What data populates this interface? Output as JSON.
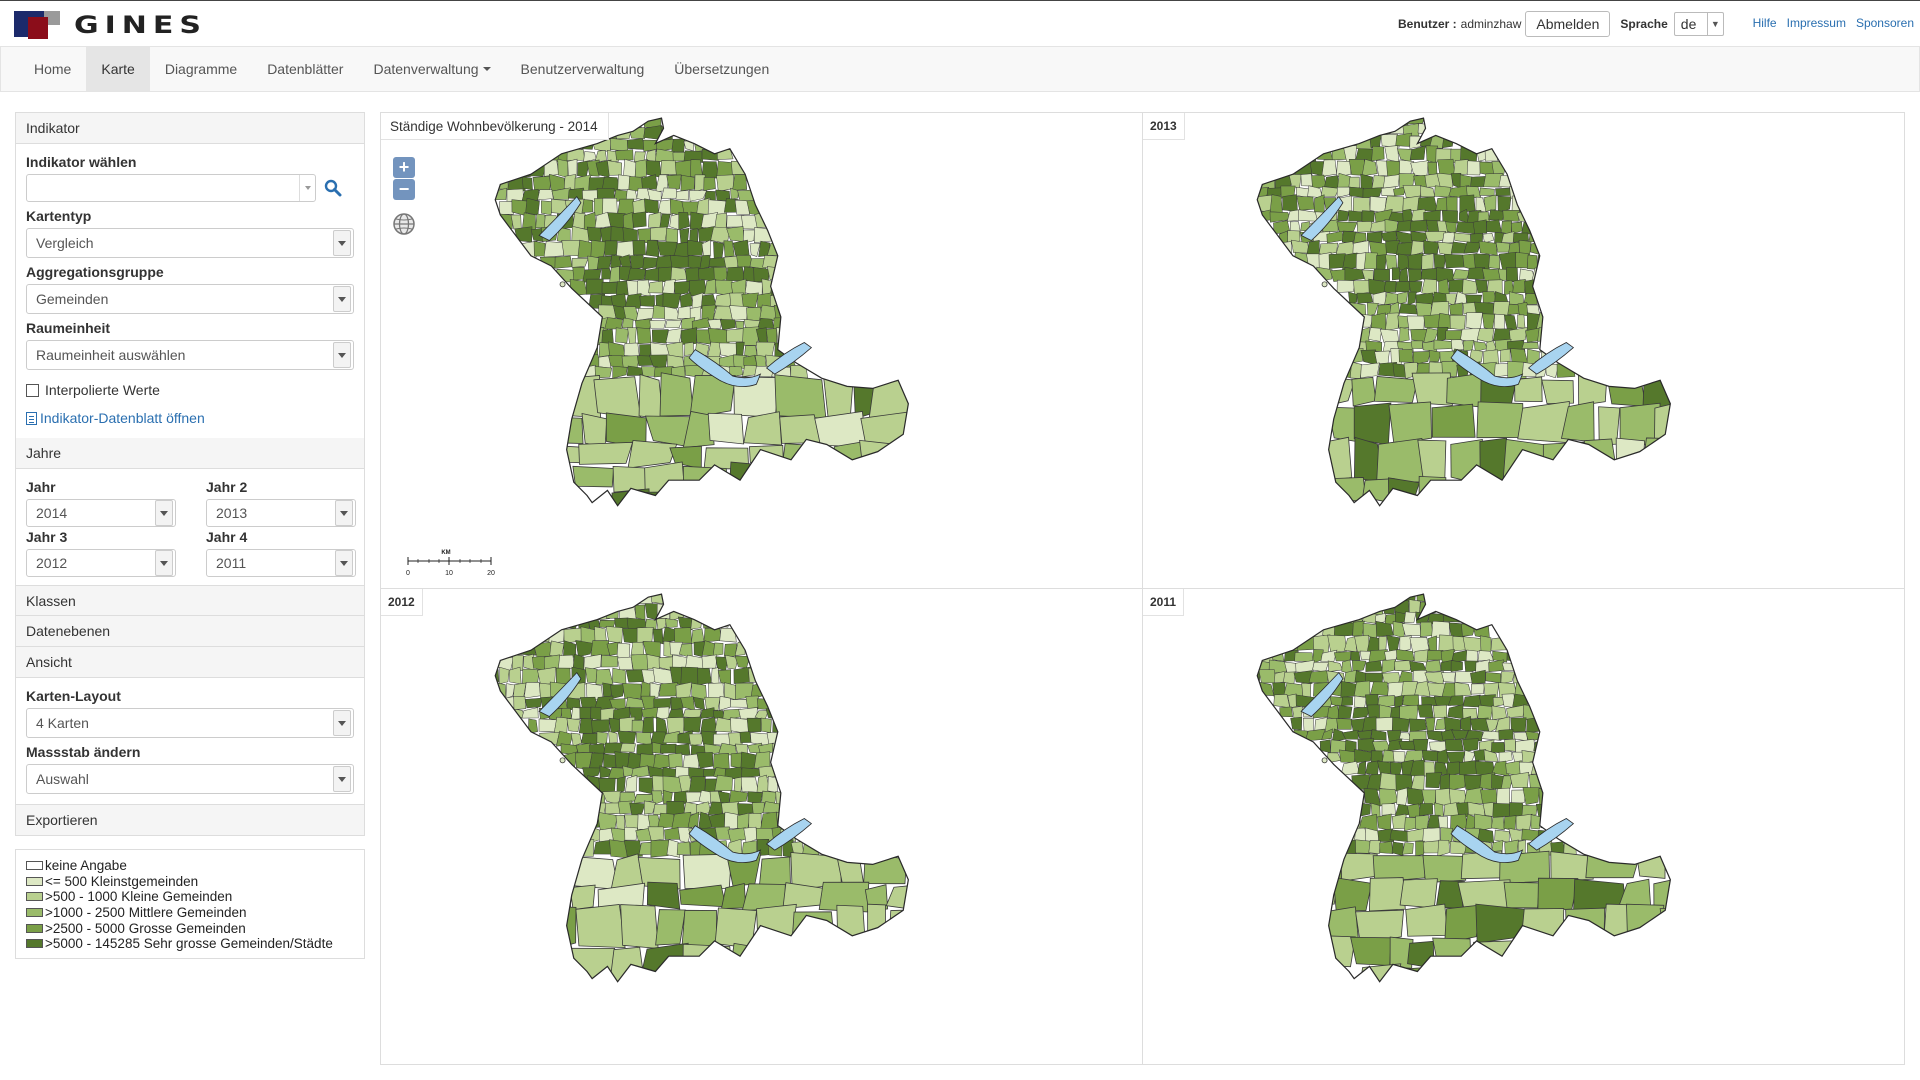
{
  "app": {
    "logo_text": "GINES"
  },
  "user": {
    "label": "Benutzer :",
    "name": "adminzhaw",
    "logout": "Abmelden",
    "lang_label": "Sprache",
    "lang_value": "de"
  },
  "top_links": [
    "Hilfe",
    "Impressum",
    "Sponsoren"
  ],
  "nav": {
    "items": [
      "Home",
      "Karte",
      "Diagramme",
      "Datenblätter",
      "Datenverwaltung",
      "Benutzerverwaltung",
      "Übersetzungen"
    ],
    "active": "Karte"
  },
  "sidebar": {
    "indikator": {
      "title": "Indikator",
      "choose_label": "Indikator wählen",
      "choose_value": "",
      "kartentyp_label": "Kartentyp",
      "kartentyp_value": "Vergleich",
      "aggregation_label": "Aggregationsgruppe",
      "aggregation_value": "Gemeinden",
      "raum_label": "Raumeinheit",
      "raum_value": "Raumeinheit auswählen",
      "interpolated_label": "Interpolierte Werte",
      "open_sheet": "Indikator-Datenblatt öffnen"
    },
    "jahre": {
      "title": "Jahre",
      "jahr1_label": "Jahr",
      "jahr1_value": "2014",
      "jahr2_label": "Jahr 2",
      "jahr2_value": "2013",
      "jahr3_label": "Jahr 3",
      "jahr3_value": "2012",
      "jahr4_label": "Jahr 4",
      "jahr4_value": "2011"
    },
    "klassen_title": "Klassen",
    "datenebenen_title": "Datenebenen",
    "ansicht": {
      "title": "Ansicht",
      "layout_label": "Karten-Layout",
      "layout_value": "4 Karten",
      "scale_label": "Massstab ändern",
      "scale_value": "Auswahl"
    },
    "export_title": "Exportieren"
  },
  "legend": [
    {
      "label": "keine Angabe",
      "color": "#ffffff"
    },
    {
      "label": "<= 500 Kleinstgemeinden",
      "color": "#dde8c4"
    },
    {
      "label": ">500 - 1000 Kleine Gemeinden",
      "color": "#b9d08f"
    },
    {
      "label": ">1000 - 2500 Mittlere Gemeinden",
      "color": "#9abb6a"
    },
    {
      "label": ">2500 - 5000 Grosse Gemeinden",
      "color": "#7a9f47"
    },
    {
      "label": ">5000 - 145285 Sehr grosse Gemeinden/Städte",
      "color": "#55782c"
    }
  ],
  "maps": [
    {
      "title": "Ständige Wohnbevölkerung - 2014"
    },
    {
      "title": "2013"
    },
    {
      "title": "2012"
    },
    {
      "title": "2011"
    }
  ],
  "map_controls": {
    "zoom_in": "+",
    "zoom_out": "−"
  },
  "scalebar": {
    "unit": "KM",
    "ticks": [
      "0",
      "10",
      "20"
    ]
  },
  "colors": {
    "lake": "#a8d4f0",
    "link": "#2a6fb0"
  }
}
